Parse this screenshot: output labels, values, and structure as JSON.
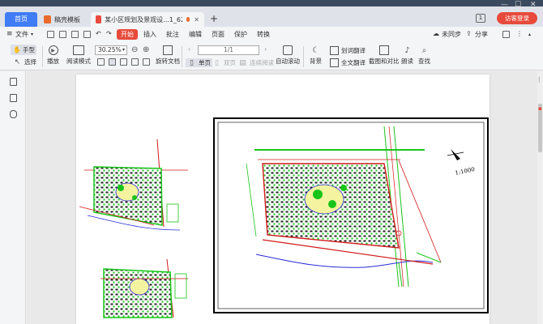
{
  "tabs": {
    "home": "首页",
    "template": "稿壳模板",
    "document": "某小区规划及景观设...1_620.pdf",
    "add": "+"
  },
  "window": {
    "badge": "1",
    "login": "访客登录"
  },
  "menu": {
    "file": "文件",
    "start": "开始",
    "insert": "插入",
    "annotate": "批注",
    "edit": "编辑",
    "page": "页面",
    "protect": "保护",
    "convert": "转换",
    "sync": "未同步",
    "share": "分享"
  },
  "toolbar": {
    "hand": "手型",
    "select": "选择",
    "play": "播放",
    "read_mode": "阅读模式",
    "zoom": "30.25%",
    "page_value": "1",
    "page_total": "/1",
    "rotate": "旋转文档",
    "single": "单页",
    "double": "双页",
    "continuous": "连续阅读",
    "auto_scroll": "自动滚动",
    "background": "背景",
    "word_translate": "划词翻译",
    "full_translate": "全文翻译",
    "screenshot": "截图和对比",
    "read_aloud": "朗读",
    "find": "查找"
  },
  "drawing": {
    "scale": "1:1000",
    "north": "N"
  },
  "colors": {
    "accent_blue": "#3f7cf5",
    "accent_red": "#e74a3b",
    "cad_green": "#19c419",
    "cad_red": "#d11a1a",
    "cad_blue": "#2a2ad8"
  }
}
